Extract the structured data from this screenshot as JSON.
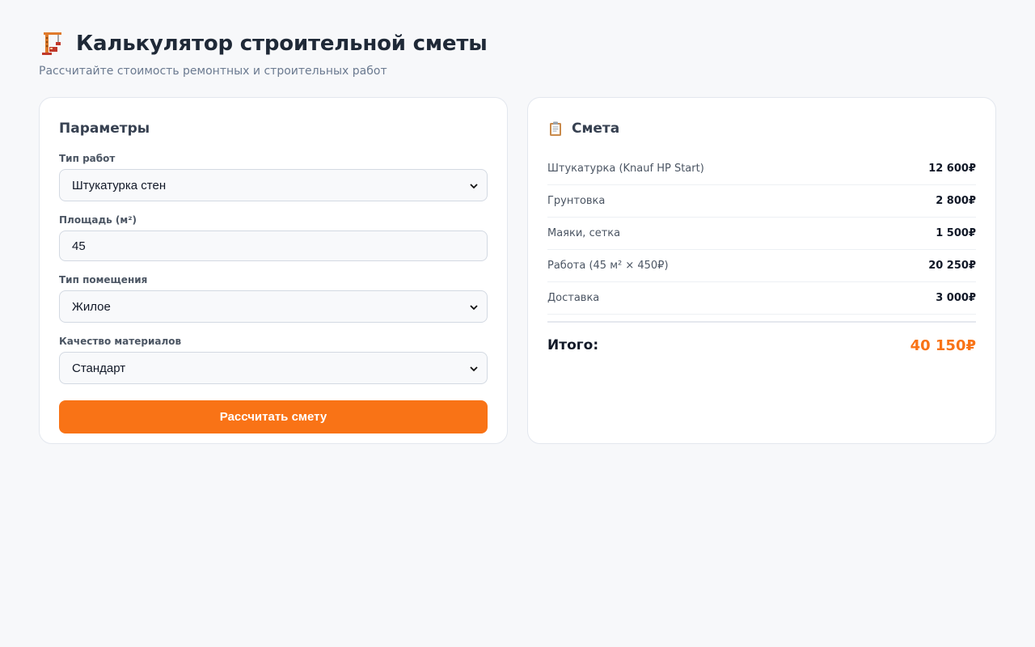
{
  "header": {
    "icon": "crane-icon",
    "title": "Калькулятор строительной сметы",
    "subtitle": "Рассчитайте стоимость ремонтных и строительных работ"
  },
  "params": {
    "heading": "Параметры",
    "work_type": {
      "label": "Тип работ",
      "value": "Штукатурка стен"
    },
    "area": {
      "label": "Площадь (м²)",
      "value": "45"
    },
    "room_type": {
      "label": "Тип помещения",
      "value": "Жилое"
    },
    "quality": {
      "label": "Качество материалов",
      "value": "Стандарт"
    },
    "submit_label": "Рассчитать смету"
  },
  "estimate": {
    "icon": "clipboard-icon",
    "heading": "Смета",
    "items": [
      {
        "name": "Штукатурка (Knauf HP Start)",
        "price": "12 600₽"
      },
      {
        "name": "Грунтовка",
        "price": "2 800₽"
      },
      {
        "name": "Маяки, сетка",
        "price": "1 500₽"
      },
      {
        "name": "Работа (45 м² × 450₽)",
        "price": "20 250₽"
      },
      {
        "name": "Доставка",
        "price": "3 000₽"
      }
    ],
    "total_label": "Итого:",
    "total_value": "40 150₽"
  },
  "colors": {
    "accent": "#f97316",
    "background": "#f7f8fa"
  }
}
